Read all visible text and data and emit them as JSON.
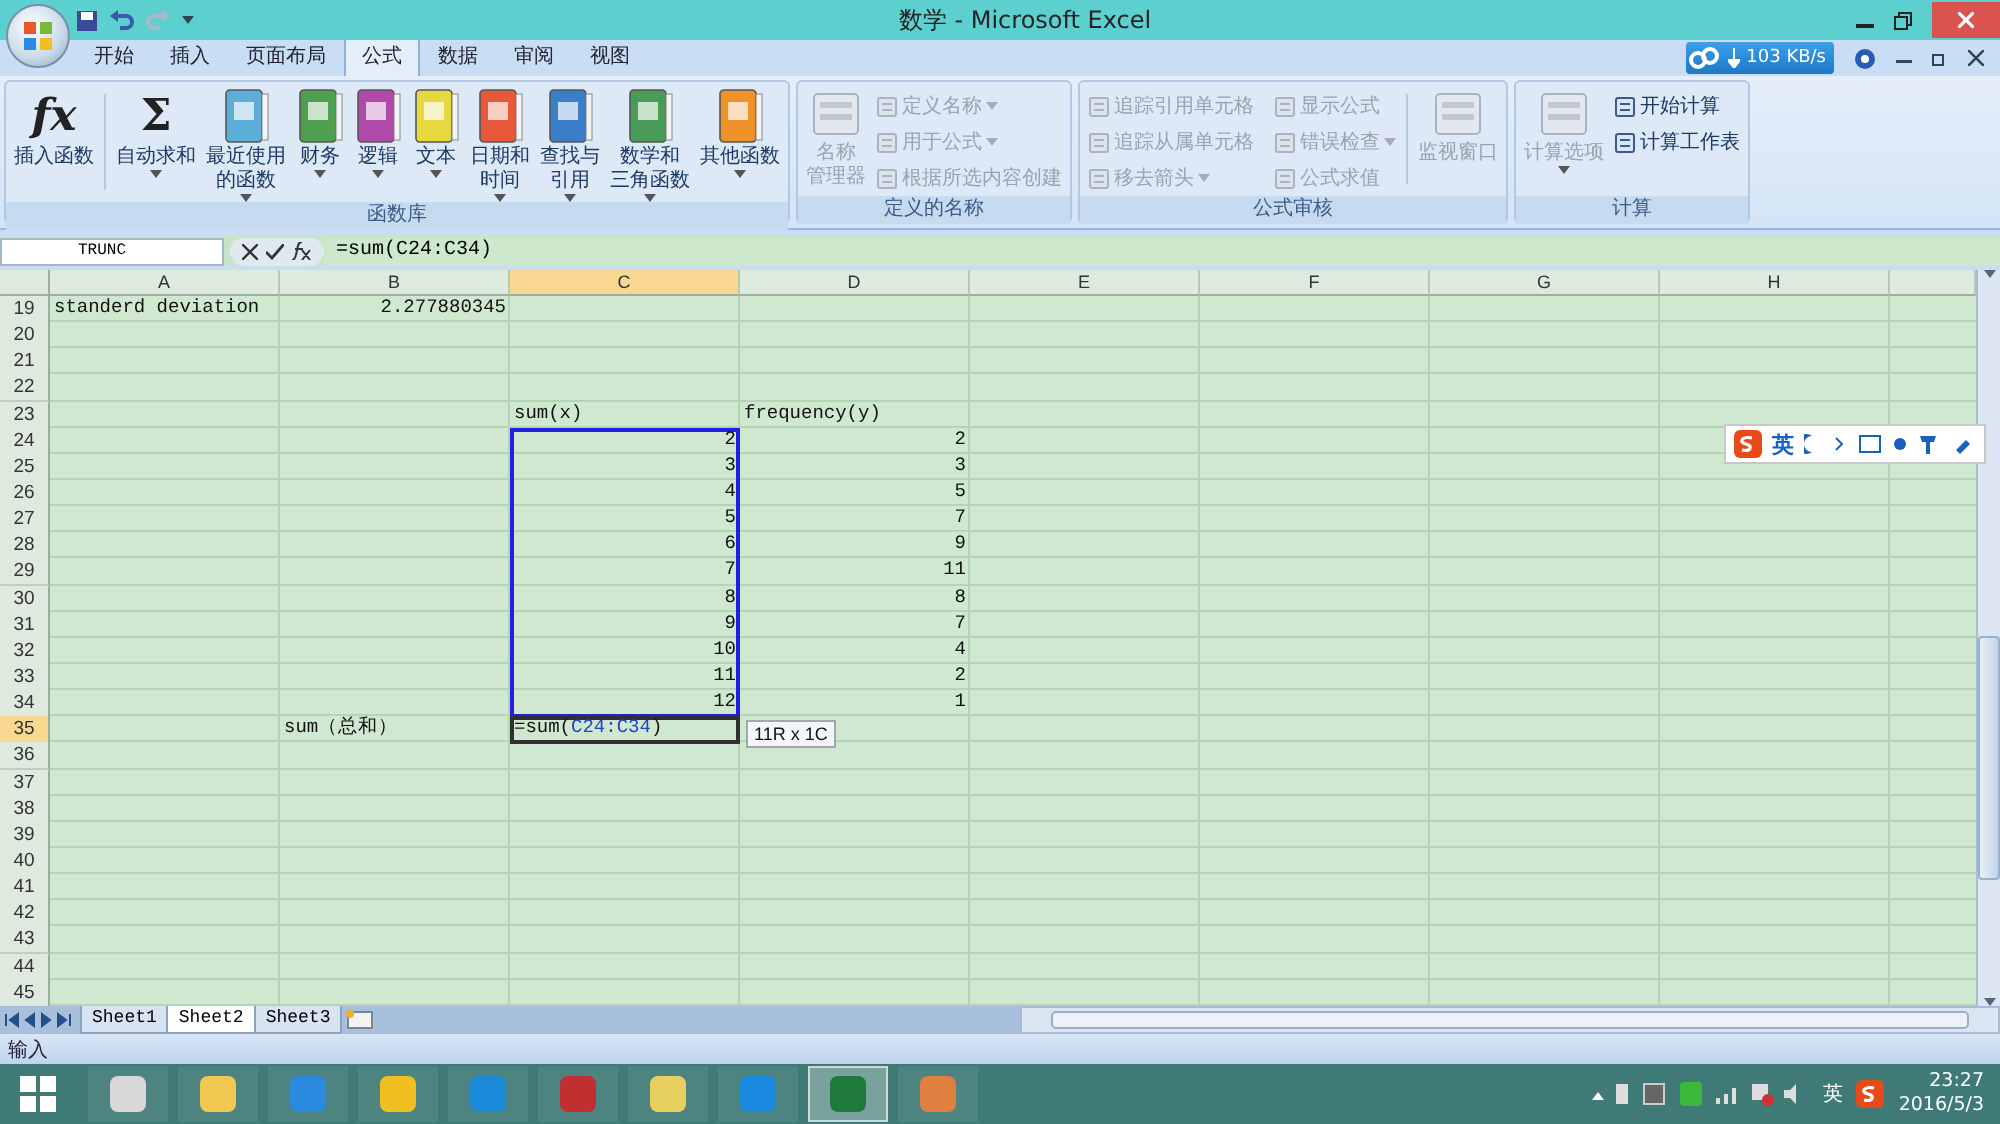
{
  "window": {
    "title": "数学 - Microsoft Excel"
  },
  "tabs": [
    {
      "label": "开始",
      "selected": false
    },
    {
      "label": "插入",
      "selected": false
    },
    {
      "label": "页面布局",
      "selected": false
    },
    {
      "label": "公式",
      "selected": true
    },
    {
      "label": "数据",
      "selected": false
    },
    {
      "label": "审阅",
      "selected": false
    },
    {
      "label": "视图",
      "selected": false
    }
  ],
  "network_speed": "103 KB/s",
  "ribbon": {
    "groups": [
      {
        "label": "函数库",
        "items": [
          {
            "kind": "glyph",
            "glyph": "fx",
            "lines": [
              "插入函数"
            ],
            "dropdown": false,
            "disabled": false
          },
          {
            "kind": "separator"
          },
          {
            "kind": "glyph",
            "glyph": "Σ",
            "lines": [
              "自动求和"
            ],
            "dropdown": true,
            "disabled": false
          },
          {
            "kind": "book",
            "color": "#5aaed8",
            "lines": [
              "最近使用",
              "的函数"
            ],
            "dropdown": true,
            "disabled": false
          },
          {
            "kind": "book",
            "color": "#4ea04e",
            "lines": [
              "财务"
            ],
            "dropdown": true,
            "disabled": false
          },
          {
            "kind": "book",
            "color": "#b04aa8",
            "lines": [
              "逻辑"
            ],
            "dropdown": true,
            "disabled": false
          },
          {
            "kind": "book",
            "color": "#e8d840",
            "lines": [
              "文本"
            ],
            "dropdown": true,
            "disabled": false
          },
          {
            "kind": "book",
            "color": "#e8583a",
            "lines": [
              "日期和",
              "时间"
            ],
            "dropdown": true,
            "disabled": false
          },
          {
            "kind": "book",
            "color": "#3a7ec8",
            "lines": [
              "查找与",
              "引用"
            ],
            "dropdown": true,
            "disabled": false
          },
          {
            "kind": "book",
            "color": "#4a9a58",
            "lines": [
              "数学和",
              "三角函数"
            ],
            "dropdown": true,
            "disabled": false
          },
          {
            "kind": "book",
            "color": "#f0922a",
            "lines": [
              "其他函数"
            ],
            "dropdown": true,
            "disabled": false
          }
        ]
      },
      {
        "label": "定义的名称",
        "items": [
          {
            "kind": "tool",
            "lines": [
              "名称",
              "管理器"
            ],
            "dropdown": false,
            "disabled": true
          },
          {
            "kind": "small",
            "label": "定义名称",
            "dropdown": true,
            "disabled": true
          },
          {
            "kind": "small",
            "label": "用于公式",
            "dropdown": true,
            "disabled": true
          },
          {
            "kind": "small",
            "label": "根据所选内容创建",
            "dropdown": false,
            "disabled": true
          }
        ]
      },
      {
        "label": "公式审核",
        "items": [
          {
            "kind": "small",
            "label": "追踪引用单元格",
            "dropdown": false,
            "disabled": true
          },
          {
            "kind": "small",
            "label": "追踪从属单元格",
            "dropdown": false,
            "disabled": true
          },
          {
            "kind": "small",
            "label": "移去箭头",
            "dropdown": true,
            "disabled": true
          },
          {
            "kind": "small",
            "label": "显示公式",
            "dropdown": false,
            "disabled": true
          },
          {
            "kind": "small",
            "label": "错误检查",
            "dropdown": true,
            "disabled": true
          },
          {
            "kind": "small",
            "label": "公式求值",
            "dropdown": false,
            "disabled": true
          },
          {
            "kind": "separator"
          },
          {
            "kind": "tool",
            "lines": [
              "监视窗口"
            ],
            "dropdown": false,
            "disabled": true
          }
        ]
      },
      {
        "label": "计算",
        "items": [
          {
            "kind": "tool",
            "lines": [
              "计算选项"
            ],
            "dropdown": true,
            "disabled": true
          },
          {
            "kind": "small",
            "label": "开始计算",
            "dropdown": false,
            "disabled": false
          },
          {
            "kind": "small",
            "label": "计算工作表",
            "dropdown": false,
            "disabled": false
          }
        ]
      }
    ]
  },
  "formula_bar": {
    "name_box": "TRUNC",
    "formula": "=sum(C24:C34)"
  },
  "sheet": {
    "columns": [
      {
        "label": "A",
        "selected": false
      },
      {
        "label": "B",
        "selected": false
      },
      {
        "label": "C",
        "selected": true
      },
      {
        "label": "D",
        "selected": false
      },
      {
        "label": "E",
        "selected": false
      },
      {
        "label": "F",
        "selected": false
      },
      {
        "label": "G",
        "selected": false
      },
      {
        "label": "H",
        "selected": false
      }
    ],
    "rows": [
      {
        "number": "19",
        "selected": false,
        "cells": {
          "col_a": {
            "kind": "text",
            "text": "standerd deviation",
            "in_range": false,
            "active": false
          },
          "col_b": {
            "kind": "number",
            "text": "2.277880345",
            "in_range": false,
            "active": false
          }
        }
      },
      {
        "number": "20",
        "selected": false
      },
      {
        "number": "21",
        "selected": false
      },
      {
        "number": "22",
        "selected": false
      },
      {
        "number": "23",
        "selected": false,
        "cells": {
          "col_c": {
            "kind": "text",
            "text": "sum(x)",
            "in_range": false,
            "active": false
          },
          "col_d": {
            "kind": "text",
            "text": "frequency(y)",
            "in_range": false,
            "active": false
          }
        }
      },
      {
        "number": "24",
        "selected": false,
        "cells": {
          "col_c": {
            "kind": "number",
            "text": "2",
            "in_range": true,
            "active": false
          },
          "col_d": {
            "kind": "number",
            "text": "2",
            "in_range": false,
            "active": false
          }
        }
      },
      {
        "number": "25",
        "selected": false,
        "cells": {
          "col_c": {
            "kind": "number",
            "text": "3",
            "in_range": true,
            "active": false
          },
          "col_d": {
            "kind": "number",
            "text": "3",
            "in_range": false,
            "active": false
          }
        }
      },
      {
        "number": "26",
        "selected": false,
        "cells": {
          "col_c": {
            "kind": "number",
            "text": "4",
            "in_range": true,
            "active": false
          },
          "col_d": {
            "kind": "number",
            "text": "5",
            "in_range": false,
            "active": false
          }
        }
      },
      {
        "number": "27",
        "selected": false,
        "cells": {
          "col_c": {
            "kind": "number",
            "text": "5",
            "in_range": true,
            "active": false
          },
          "col_d": {
            "kind": "number",
            "text": "7",
            "in_range": false,
            "active": false
          }
        }
      },
      {
        "number": "28",
        "selected": false,
        "cells": {
          "col_c": {
            "kind": "number",
            "text": "6",
            "in_range": true,
            "active": false
          },
          "col_d": {
            "kind": "number",
            "text": "9",
            "in_range": false,
            "active": false
          }
        }
      },
      {
        "number": "29",
        "selected": false,
        "cells": {
          "col_c": {
            "kind": "number",
            "text": "7",
            "in_range": true,
            "active": false
          },
          "col_d": {
            "kind": "number",
            "text": "11",
            "in_range": false,
            "active": false
          }
        }
      },
      {
        "number": "30",
        "selected": false,
        "cells": {
          "col_c": {
            "kind": "number",
            "text": "8",
            "in_range": true,
            "active": false
          },
          "col_d": {
            "kind": "number",
            "text": "8",
            "in_range": false,
            "active": false
          }
        }
      },
      {
        "number": "31",
        "selected": false,
        "cells": {
          "col_c": {
            "kind": "number",
            "text": "9",
            "in_range": true,
            "active": false
          },
          "col_d": {
            "kind": "number",
            "text": "7",
            "in_range": false,
            "active": false
          }
        }
      },
      {
        "number": "32",
        "selected": false,
        "cells": {
          "col_c": {
            "kind": "number",
            "text": "10",
            "in_range": true,
            "active": false
          },
          "col_d": {
            "kind": "number",
            "text": "4",
            "in_range": false,
            "active": false
          }
        }
      },
      {
        "number": "33",
        "selected": false,
        "cells": {
          "col_c": {
            "kind": "number",
            "text": "11",
            "in_range": true,
            "active": false
          },
          "col_d": {
            "kind": "number",
            "text": "2",
            "in_range": false,
            "active": false
          }
        }
      },
      {
        "number": "34",
        "selected": false,
        "cells": {
          "col_c": {
            "kind": "number",
            "text": "12",
            "in_range": true,
            "active": false
          },
          "col_d": {
            "kind": "number",
            "text": "1",
            "in_range": false,
            "active": false
          }
        }
      },
      {
        "number": "35",
        "selected": true,
        "cells": {
          "col_b": {
            "kind": "text",
            "text": "sum（总和）",
            "in_range": false,
            "active": false
          },
          "col_c": {
            "kind": "formula",
            "parts": [
              {
                "kind": "plain",
                "text": "=sum("
              },
              {
                "kind": "reference",
                "text": "C24:C34"
              },
              {
                "kind": "plain",
                "text": ")"
              }
            ],
            "in_range": false,
            "active": true,
            "tooltip": "11R x 1C"
          }
        }
      },
      {
        "number": "36",
        "selected": false
      },
      {
        "number": "37",
        "selected": false
      },
      {
        "number": "38",
        "selected": false
      },
      {
        "number": "39",
        "selected": false
      },
      {
        "number": "40",
        "selected": false
      },
      {
        "number": "41",
        "selected": false
      },
      {
        "number": "42",
        "selected": false
      },
      {
        "number": "43",
        "selected": false
      },
      {
        "number": "44",
        "selected": false
      },
      {
        "number": "45",
        "selected": false
      }
    ],
    "tabs": [
      {
        "label": "Sheet1",
        "selected": false
      },
      {
        "label": "Sheet2",
        "selected": true
      },
      {
        "label": "Sheet3",
        "selected": false
      }
    ]
  },
  "ime_bar": {
    "label": "英"
  },
  "status_bar": {
    "mode": "输入"
  },
  "taskbar": {
    "apps": [
      {
        "color": "#d8d8d8",
        "selected": false
      },
      {
        "color": "#f0c850",
        "selected": false
      },
      {
        "color": "#2a8ae0",
        "selected": false
      },
      {
        "color": "#f0c020",
        "selected": false
      },
      {
        "color": "#1a8ad8",
        "selected": false
      },
      {
        "color": "#c03030",
        "selected": false
      },
      {
        "color": "#e8d060",
        "selected": false
      },
      {
        "color": "#1a8ae0",
        "selected": false
      },
      {
        "color": "#1e7a3a",
        "selected": true
      },
      {
        "color": "#e08040",
        "selected": false
      }
    ],
    "tray_language": "英",
    "time": "23:27",
    "date": "2016/5/3"
  }
}
